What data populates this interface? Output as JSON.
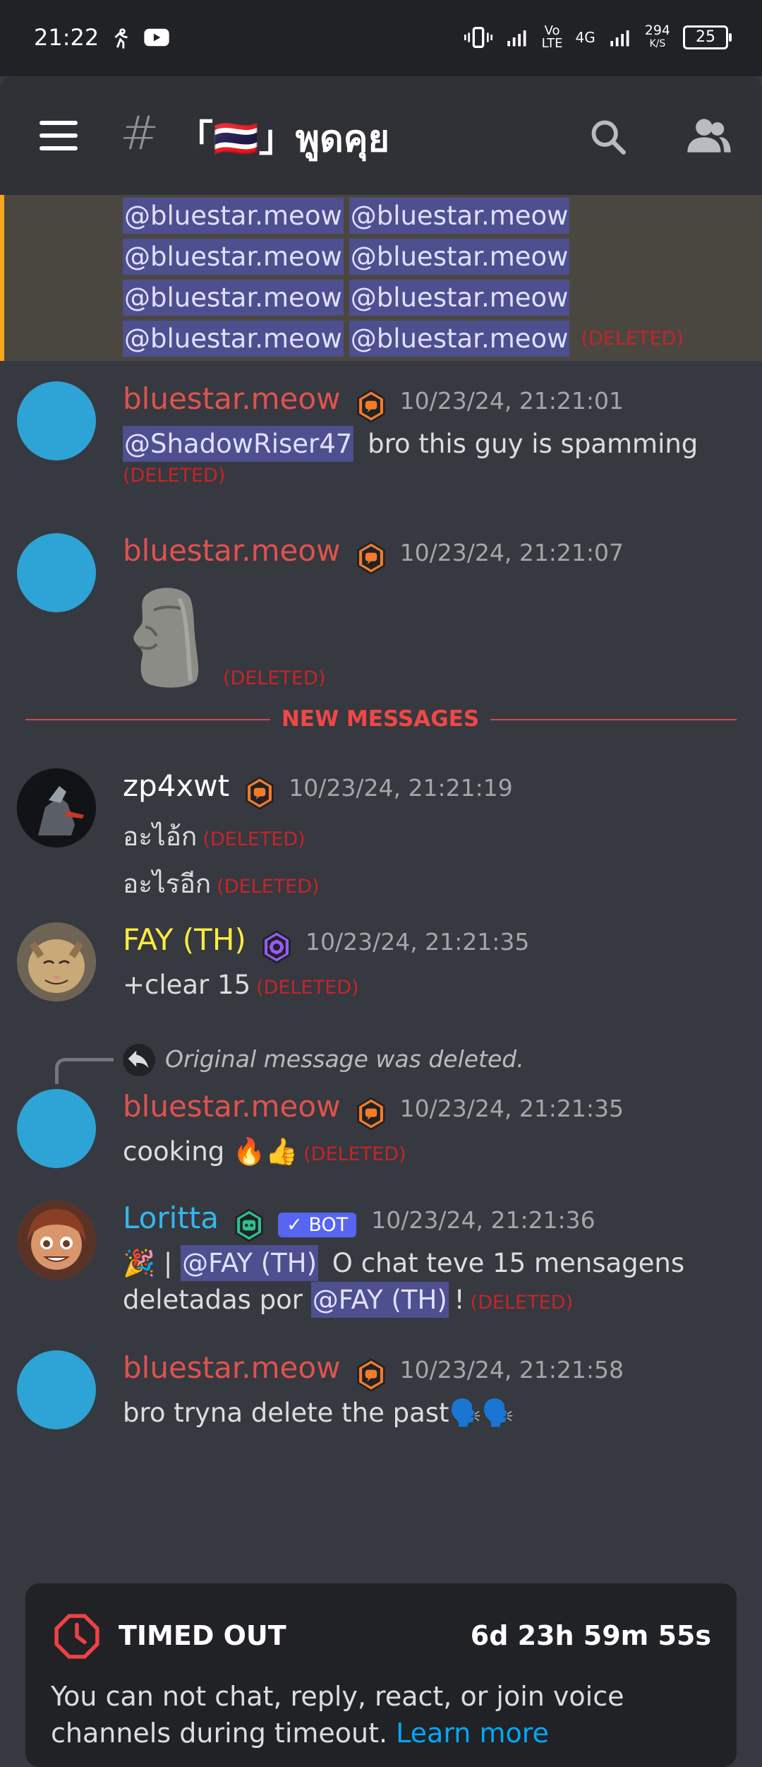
{
  "status_bar": {
    "time": "21:22",
    "net_speed": "294",
    "net_unit": "K/S",
    "battery": "25",
    "network_vo": "Vo",
    "network_lte": "LTE",
    "network_4g": "4G"
  },
  "header": {
    "channel_name": "「🇹🇭」พูดคุย"
  },
  "mentions": {
    "items": [
      "@bluestar.meow",
      "@bluestar.meow",
      "@bluestar.meow",
      "@bluestar.meow",
      "@bluestar.meow",
      "@bluestar.meow",
      "@bluestar.meow",
      "@bluestar.meow"
    ],
    "deleted": "(DELETED)"
  },
  "messages": [
    {
      "username": "bluestar.meow",
      "timestamp": "10/23/24, 21:21:01",
      "mention": "@ShadowRiser47",
      "text": " bro this guy is spamming",
      "deleted": "(DELETED)"
    },
    {
      "username": "bluestar.meow",
      "timestamp": "10/23/24, 21:21:07",
      "deleted": "(DELETED)"
    },
    {
      "username": "zp4xwt",
      "timestamp": "10/23/24, 21:21:19",
      "line1": "อะไอ้ก",
      "line2": "อะไรอีก",
      "deleted": "(DELETED)"
    },
    {
      "username": "FAY (TH)",
      "timestamp": "10/23/24, 21:21:35",
      "text": "+clear 15",
      "deleted": "(DELETED)"
    },
    {
      "username": "bluestar.meow",
      "timestamp": "10/23/24, 21:21:35",
      "reply": "Original message was deleted.",
      "text": "cooking 🔥👍",
      "deleted": "(DELETED)"
    },
    {
      "username": "Loritta",
      "bot_label": "BOT",
      "timestamp": "10/23/24, 21:21:36",
      "prefix": "🎉 | ",
      "mention": "@FAY (TH)",
      "text": " O chat teve 15 mensagens",
      "text2": "deletadas por ",
      "mention2": "@FAY (TH)",
      "text2_end": "!",
      "deleted": "(DELETED)"
    },
    {
      "username": "bluestar.meow",
      "timestamp": "10/23/24, 21:21:58",
      "text": "bro tryna delete the past🗣️🗣️"
    }
  ],
  "divider": {
    "label": "NEW MESSAGES"
  },
  "timeout": {
    "title": "TIMED OUT",
    "remaining": "6d 23h 59m 55s",
    "text": "You can not chat, reply, react, or join voice channels during timeout.",
    "link": "Learn more"
  },
  "colors": {
    "accent_red": "#e0524e",
    "mention_bg": "#4d4f8f",
    "deleted": "#c4252a",
    "bot": "#5865f2",
    "highlight_border": "#faa61a"
  }
}
